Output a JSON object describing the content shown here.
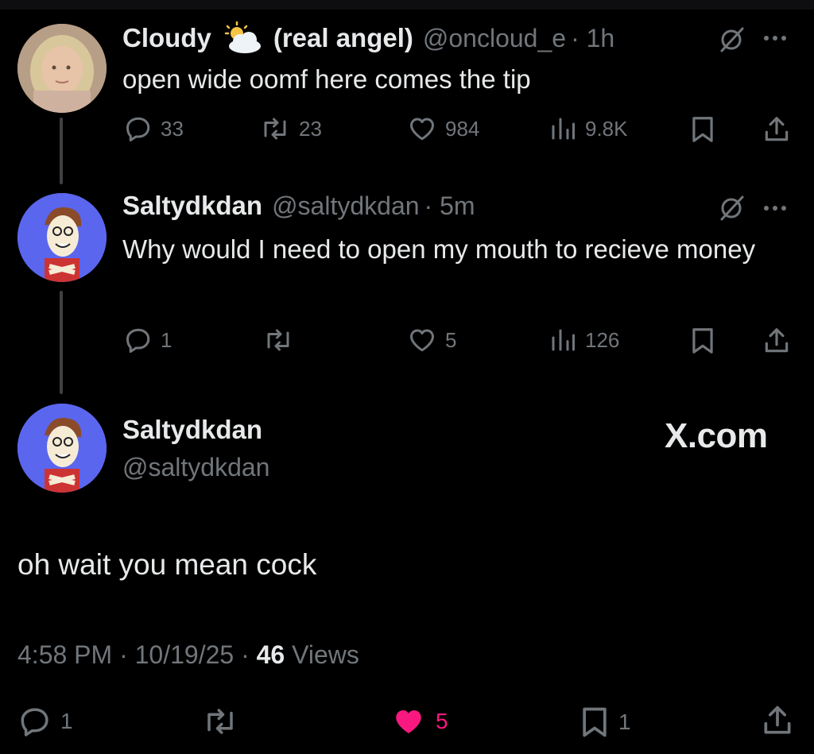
{
  "tweet1": {
    "name": "Cloudy",
    "name_suffix": "(real angel)",
    "handle": "@oncloud_e",
    "time": "· 1h",
    "text": "open wide oomf here comes the tip",
    "replies": "33",
    "reposts": "23",
    "likes": "984",
    "views": "9.8K",
    "weather_icon": "sun-behind-cloud-icon"
  },
  "tweet2": {
    "name": "Saltydkdan",
    "handle": "@saltydkdan",
    "time": "· 5m",
    "text": "Why would I need to open my mouth to recieve money",
    "replies": "1",
    "likes": "5",
    "views": "126"
  },
  "main_tweet": {
    "name": "Saltydkdan",
    "handle": "@saltydkdan",
    "text": "oh wait you mean cock",
    "time": "4:58 PM",
    "date": "10/19/25",
    "views_count": "46",
    "views_label": "Views",
    "replies": "1",
    "likes": "5",
    "bookmarks": "1",
    "watermark": "X.com"
  },
  "colors": {
    "background": "#000000",
    "text": "#e7e9ea",
    "muted": "#71767b",
    "like_active": "#f91880"
  }
}
